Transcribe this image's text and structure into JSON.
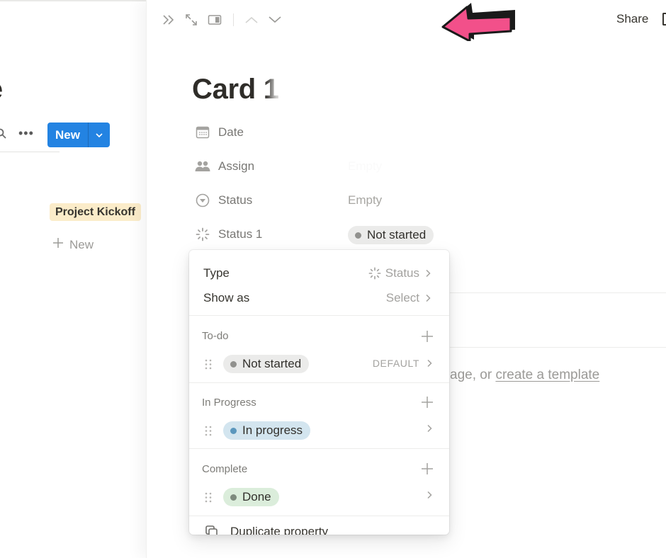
{
  "background_page": {
    "title_fragment": "ge",
    "new_button_label": "New",
    "card_tag": "Project Kickoff",
    "add_new_label": "New"
  },
  "topbar": {
    "share_label": "Share",
    "annotation_arrow_color": "#f2508a"
  },
  "card": {
    "title": "Card 1",
    "properties": [
      {
        "icon": "calendar-icon",
        "label": "Date",
        "value": ""
      },
      {
        "icon": "people-icon",
        "label": "Assign",
        "value": "Empty"
      },
      {
        "icon": "select-circle-icon",
        "label": "Status",
        "value": "Empty"
      },
      {
        "icon": "status-spinner-icon",
        "label": "Status 1",
        "value": "Not started"
      }
    ],
    "template_hint": {
      "prefix": "age, or ",
      "link": "create a template"
    }
  },
  "property_menu": {
    "type": {
      "label": "Type",
      "value": "Status"
    },
    "show_as": {
      "label": "Show as",
      "value": "Select"
    },
    "groups": [
      {
        "title": "To-do",
        "options": [
          {
            "label": "Not started",
            "color": "gray",
            "badge": "DEFAULT"
          }
        ]
      },
      {
        "title": "In Progress",
        "options": [
          {
            "label": "In progress",
            "color": "blue",
            "badge": ""
          }
        ]
      },
      {
        "title": "Complete",
        "options": [
          {
            "label": "Done",
            "color": "green",
            "badge": ""
          }
        ]
      }
    ],
    "duplicate_label": "Duplicate property"
  },
  "colors": {
    "accent_blue": "#2383e2",
    "tag_yellow": "#fbecc9",
    "pill_gray": "#ebebea",
    "pill_blue": "#d3e5ef",
    "pill_green": "#dbeddb"
  }
}
